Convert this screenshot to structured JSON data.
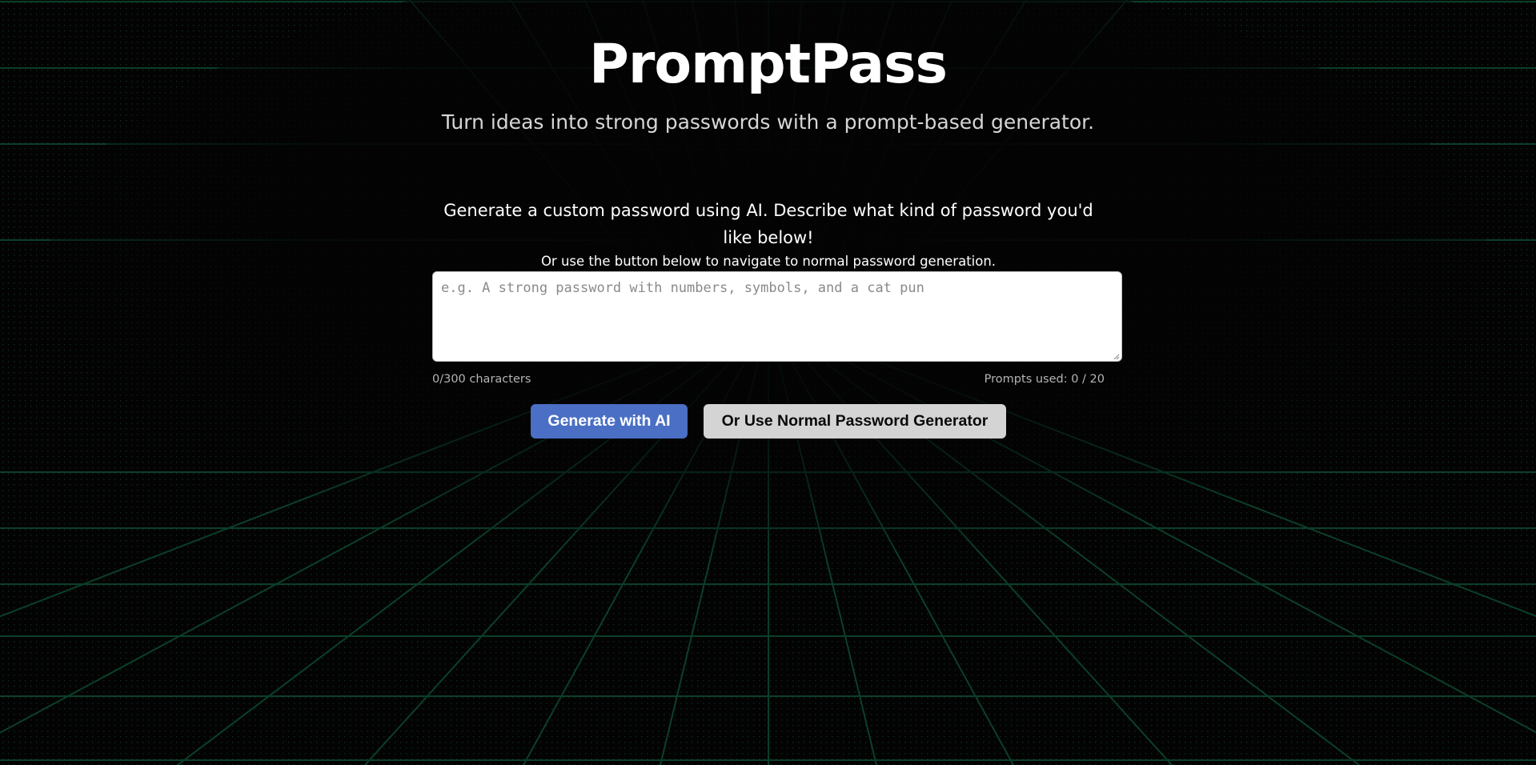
{
  "app": {
    "title": "PromptPass",
    "subtitle": "Turn ideas into strong passwords with a prompt-based generator."
  },
  "main": {
    "instruction": "Generate a custom password using AI. Describe what kind of password you'd like below!",
    "instruction_sub": "Or use the button below to navigate to normal password generation.",
    "prompt": {
      "value": "",
      "placeholder": "e.g. A strong password with numbers, symbols, and a cat pun"
    },
    "char_count": "0/300 characters",
    "prompts_used": "Prompts used: 0 / 20"
  },
  "buttons": {
    "generate_ai_label": "Generate with AI",
    "normal_generator_label": "Or Use Normal Password Generator"
  },
  "colors": {
    "background": "#030303",
    "grid_line": "#0f4a2f",
    "primary_button": "#4a6fc4",
    "secondary_button": "#d4d4d4"
  }
}
